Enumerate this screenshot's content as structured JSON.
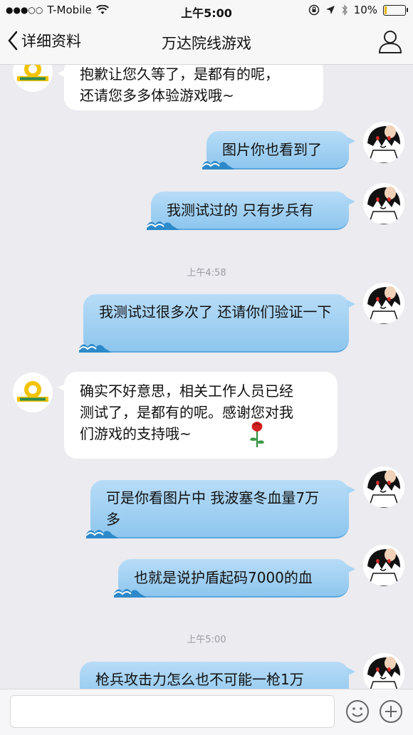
{
  "status_bar": {
    "signal_dots": "●●●○○",
    "carrier": "T-Mobile",
    "time": "上午5:00",
    "battery_percent": "10%",
    "battery_level": 0.1
  },
  "nav": {
    "back_label": "详细资料",
    "title": "万达院线游戏"
  },
  "messages": [
    {
      "side": "left",
      "text": "抱歉让您久等了，是都有的呢，\n还请您多多体验游戏哦~"
    },
    {
      "side": "right",
      "text": "图片你也看到了"
    },
    {
      "side": "right",
      "text": "我测试过的 只有步兵有"
    },
    {
      "type": "timestamp",
      "text": "上午4:58"
    },
    {
      "side": "right",
      "text": "我测试过很多次了 还请你们验证一下"
    },
    {
      "side": "left",
      "text": "确实不好意思，相关工作人员已经测试了，是都有的呢。感谢您对我们游戏的支持哦~"
    },
    {
      "side": "right",
      "text": "可是你看图片中 我波塞冬血量7万多"
    },
    {
      "side": "right",
      "text": "也就是说护盾起码7000的血"
    },
    {
      "type": "timestamp",
      "text": "上午5:00"
    },
    {
      "side": "right",
      "text": "枪兵攻击力怎么也不可能一枪1万"
    }
  ],
  "icons": {
    "back": "chevron-left-icon",
    "profile": "person-icon",
    "emoji": "smiley-icon",
    "plus": "plus-circle-icon",
    "rose": "rose-icon"
  },
  "colors": {
    "bubble_right": "#a9d5f4",
    "bubble_left": "#ffffff",
    "background": "#ebebf0"
  }
}
